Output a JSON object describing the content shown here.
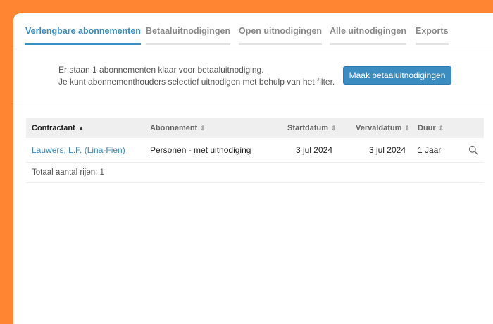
{
  "tabs": [
    {
      "label": "Verlengbare abonnementen",
      "active": true
    },
    {
      "label": "Betaaluitnodigingen",
      "active": false
    },
    {
      "label": "Open uitnodigingen",
      "active": false
    },
    {
      "label": "Alle uitnodigingen",
      "active": false
    },
    {
      "label": "Exports",
      "active": false
    }
  ],
  "info": {
    "line1": "Er staan 1 abonnementen klaar voor betaaluitnodiging.",
    "line2": "Je kunt abonnementhouders selectief uitnodigen met behulp van het filter."
  },
  "primary_button": "Maak betaaluitnodigingen",
  "table": {
    "columns": [
      "Contractant",
      "Abonnement",
      "Startdatum",
      "Vervaldatum",
      "Duur"
    ],
    "sort_icons": {
      "active": "▲",
      "inactive": "⇕"
    },
    "rows": [
      {
        "contractant": "Lauwers, L.F. (Lina-Fien)",
        "abonnement": "Personen - met uitnodiging",
        "startdatum": "3 jul 2024",
        "vervaldatum": "3 jul 2024",
        "duur": "1 Jaar",
        "action_icon": "search-icon"
      }
    ],
    "footer": "Totaal aantal rijen: 1"
  },
  "colors": {
    "accent": "#3a8cc1",
    "frame": "#ff8533"
  }
}
